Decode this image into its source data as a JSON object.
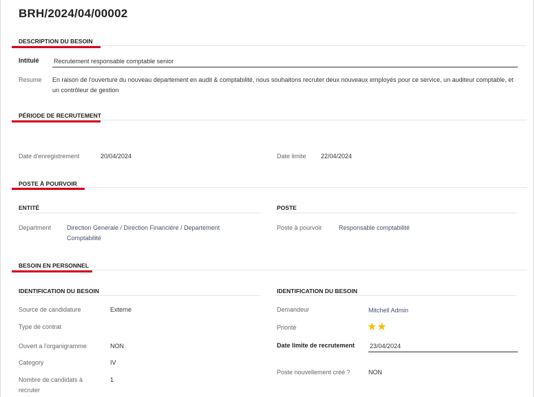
{
  "record": {
    "ref": "BRH/2024/04/00002"
  },
  "sections": {
    "description": "DESCRIPTION DU BESOIN",
    "periode": "PÉRIODE DE RECRUTEMENT",
    "poste": "POSTE À POURVOIR",
    "besoin": "BESOIN EN PERSONNEL"
  },
  "description": {
    "intitule_label": "Intitulé",
    "intitule_value": "Recrutement responsable comptable senior",
    "resume_label": "Resume",
    "resume_value": "En raison de l'ouverture du nouveau departement en audit & comptabilité, nous souhaitons recruter deux nouveaux employés pour ce service, un auditeur comptable, et un contrôleur de gestion"
  },
  "periode": {
    "date_enreg_label": "Date d'enregistrement",
    "date_enreg_value": "20/04/2024",
    "date_limite_label": "Date limite",
    "date_limite_value": "22/04/2024"
  },
  "poste": {
    "entite_title": "ENTITÉ",
    "department_label": "Department",
    "department_value": "Direction Generale / Direction Financière / Departement Comptabilité",
    "poste_title": "POSTE",
    "poste_label": "Poste à pourvoir",
    "poste_value": "Responsable comptabilité"
  },
  "besoin": {
    "left_title": "IDENTIFICATION DU BESOIN",
    "right_title": "IDENTIFICATION DU BESOIN",
    "source_label": "Source de candidature",
    "source_value": "Externe",
    "type_label": "Type de contrat",
    "ouvert_label": "Ouvert a l'organigramme",
    "ouvert_value": "NON",
    "category_label": "Category",
    "category_value": "IV",
    "nombre_label": "Nombre de candidats à recruter",
    "nombre_value": "1",
    "demandeur_label": "Demandeur",
    "demandeur_value": "Mitchell Admin",
    "priorite_label": "Priorité",
    "priorite_stars": 2,
    "date_limite_rec_label": "Date limite de recrutement",
    "date_limite_rec_value": "23/04/2024",
    "poste_cree_label": "Poste nouvellement créé ?",
    "poste_cree_value": "NON"
  },
  "colors": {
    "accent": "#d9001b",
    "star": "#f3c000",
    "link": "#46506e"
  },
  "icons": {
    "star": "star-icon"
  }
}
